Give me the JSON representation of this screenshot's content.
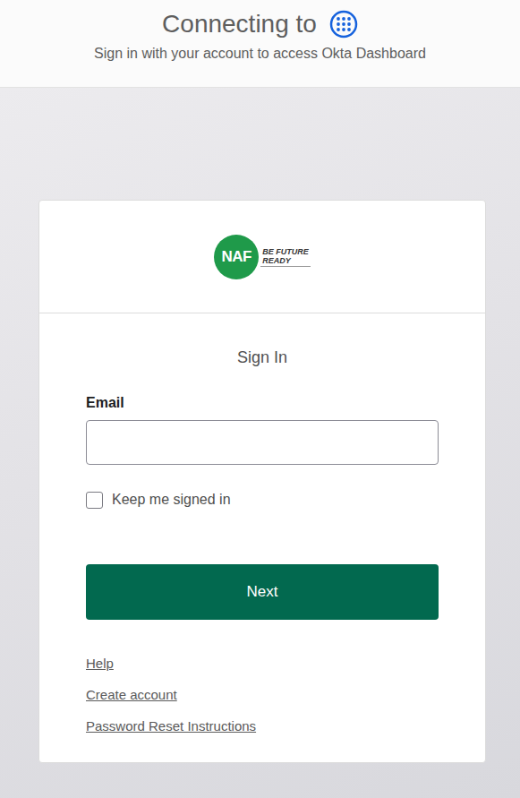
{
  "header": {
    "title": "Connecting to",
    "subtitle": "Sign in with your account to access Okta Dashboard"
  },
  "logo": {
    "mark": "NAF",
    "tagline": [
      "BE FUTURE",
      "READY"
    ]
  },
  "form": {
    "title": "Sign In",
    "fields": [
      {
        "label": "Email"
      }
    ],
    "keep_signed_in": {
      "label": "Keep me signed in",
      "checked": false
    },
    "submit": "Next"
  },
  "links": [
    "Help",
    "Create account",
    "Password Reset Instructions"
  ]
}
